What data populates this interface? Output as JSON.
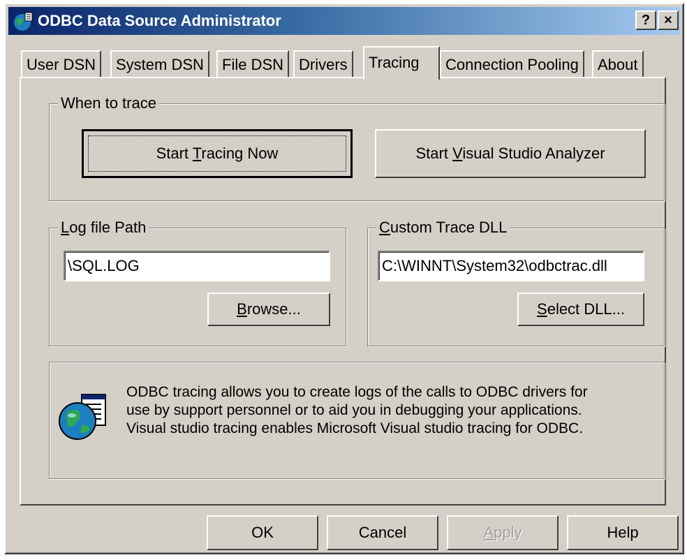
{
  "window": {
    "title": "ODBC Data Source Administrator",
    "help_label": "?",
    "close_label": "×"
  },
  "tabs": [
    {
      "label": "User DSN"
    },
    {
      "label": "System DSN"
    },
    {
      "label": "File DSN"
    },
    {
      "label": "Drivers"
    },
    {
      "label": "Tracing",
      "active": true
    },
    {
      "label": "Connection Pooling"
    },
    {
      "label": "About"
    }
  ],
  "when_to_trace": {
    "label": "When to trace",
    "start_tracing_pre": "Start ",
    "start_tracing_u": "T",
    "start_tracing_post": "racing Now",
    "vs_analyzer_pre": "Start ",
    "vs_analyzer_u": "V",
    "vs_analyzer_post": "isual Studio Analyzer"
  },
  "log_file": {
    "label_u": "L",
    "label_rest": "og file Path",
    "value": "\\SQL.LOG",
    "browse_u": "B",
    "browse_rest": "rowse..."
  },
  "custom_dll": {
    "label_u": "C",
    "label_rest": "ustom Trace DLL",
    "value": "C:\\WINNT\\System32\\odbctrac.dll",
    "select_u": "S",
    "select_rest": "elect DLL..."
  },
  "info": {
    "line1": "ODBC tracing allows you to create logs of the calls to ODBC drivers for",
    "line2": "use by support personnel or to aid you in debugging your applications.",
    "line3": "Visual studio tracing enables Microsoft Visual studio tracing for ODBC."
  },
  "footer": {
    "ok": "OK",
    "cancel": "Cancel",
    "apply_u": "A",
    "apply_rest": "pply",
    "help": "Help"
  },
  "colors": {
    "face": "#d4d0c8",
    "title_start": "#0a246a",
    "title_end": "#a6caf0"
  }
}
